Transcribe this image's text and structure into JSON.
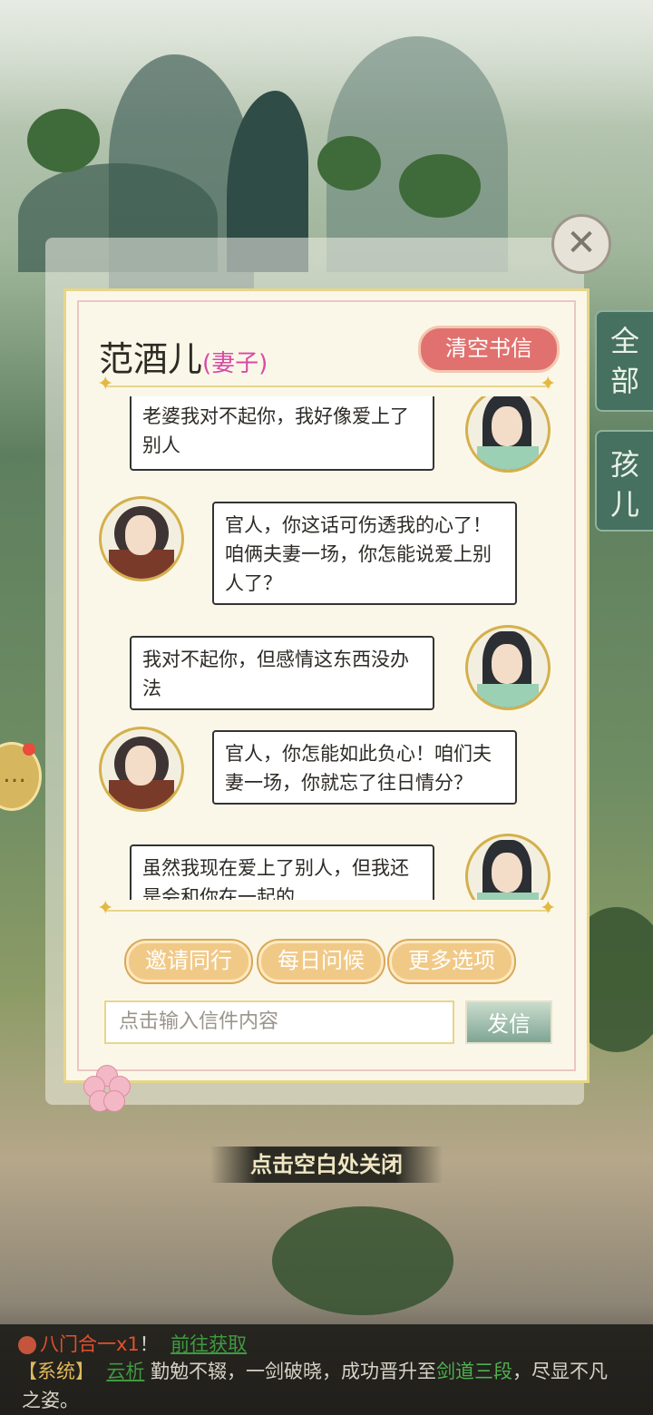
{
  "panel": {
    "title_name": "范酒儿",
    "title_role": "(妻子)",
    "clear_button": "清空书信"
  },
  "side_tabs": [
    {
      "label": "全部"
    },
    {
      "label": "孩儿"
    }
  ],
  "messages": [
    {
      "side": "right",
      "speaker": "male",
      "text": "老婆我对不起你，我好像爱上了别人"
    },
    {
      "side": "left",
      "speaker": "female",
      "text": "官人，你这话可伤透我的心了！咱俩夫妻一场，你怎能说爱上别人了？"
    },
    {
      "side": "right",
      "speaker": "male",
      "text": "我对不起你，但感情这东西没办法"
    },
    {
      "side": "left",
      "speaker": "female",
      "text": "官人，你怎能如此负心！咱们夫妻一场，你就忘了往日情分？"
    },
    {
      "side": "right",
      "speaker": "male",
      "text": "虽然我现在爱上了别人，但我还是会和你在一起的"
    }
  ],
  "actions": [
    {
      "label": "邀请同行"
    },
    {
      "label": "每日问候"
    },
    {
      "label": "更多选项"
    }
  ],
  "input": {
    "placeholder": "点击输入信件内容"
  },
  "send_button": "发信",
  "close_hint": "点击空白处关闭",
  "bottom_bar": {
    "line1_item": "八门合一x1",
    "line1_sep": "！",
    "line1_link": "前往获取",
    "line2_tag": "【系统】",
    "line2_name": "云析",
    "line2_text1": "勤勉不辍，一剑破晓，成功晋升至",
    "line2_rank": "剑道三段",
    "line2_text2": "，尽显不凡",
    "line3_text": "之姿。"
  }
}
